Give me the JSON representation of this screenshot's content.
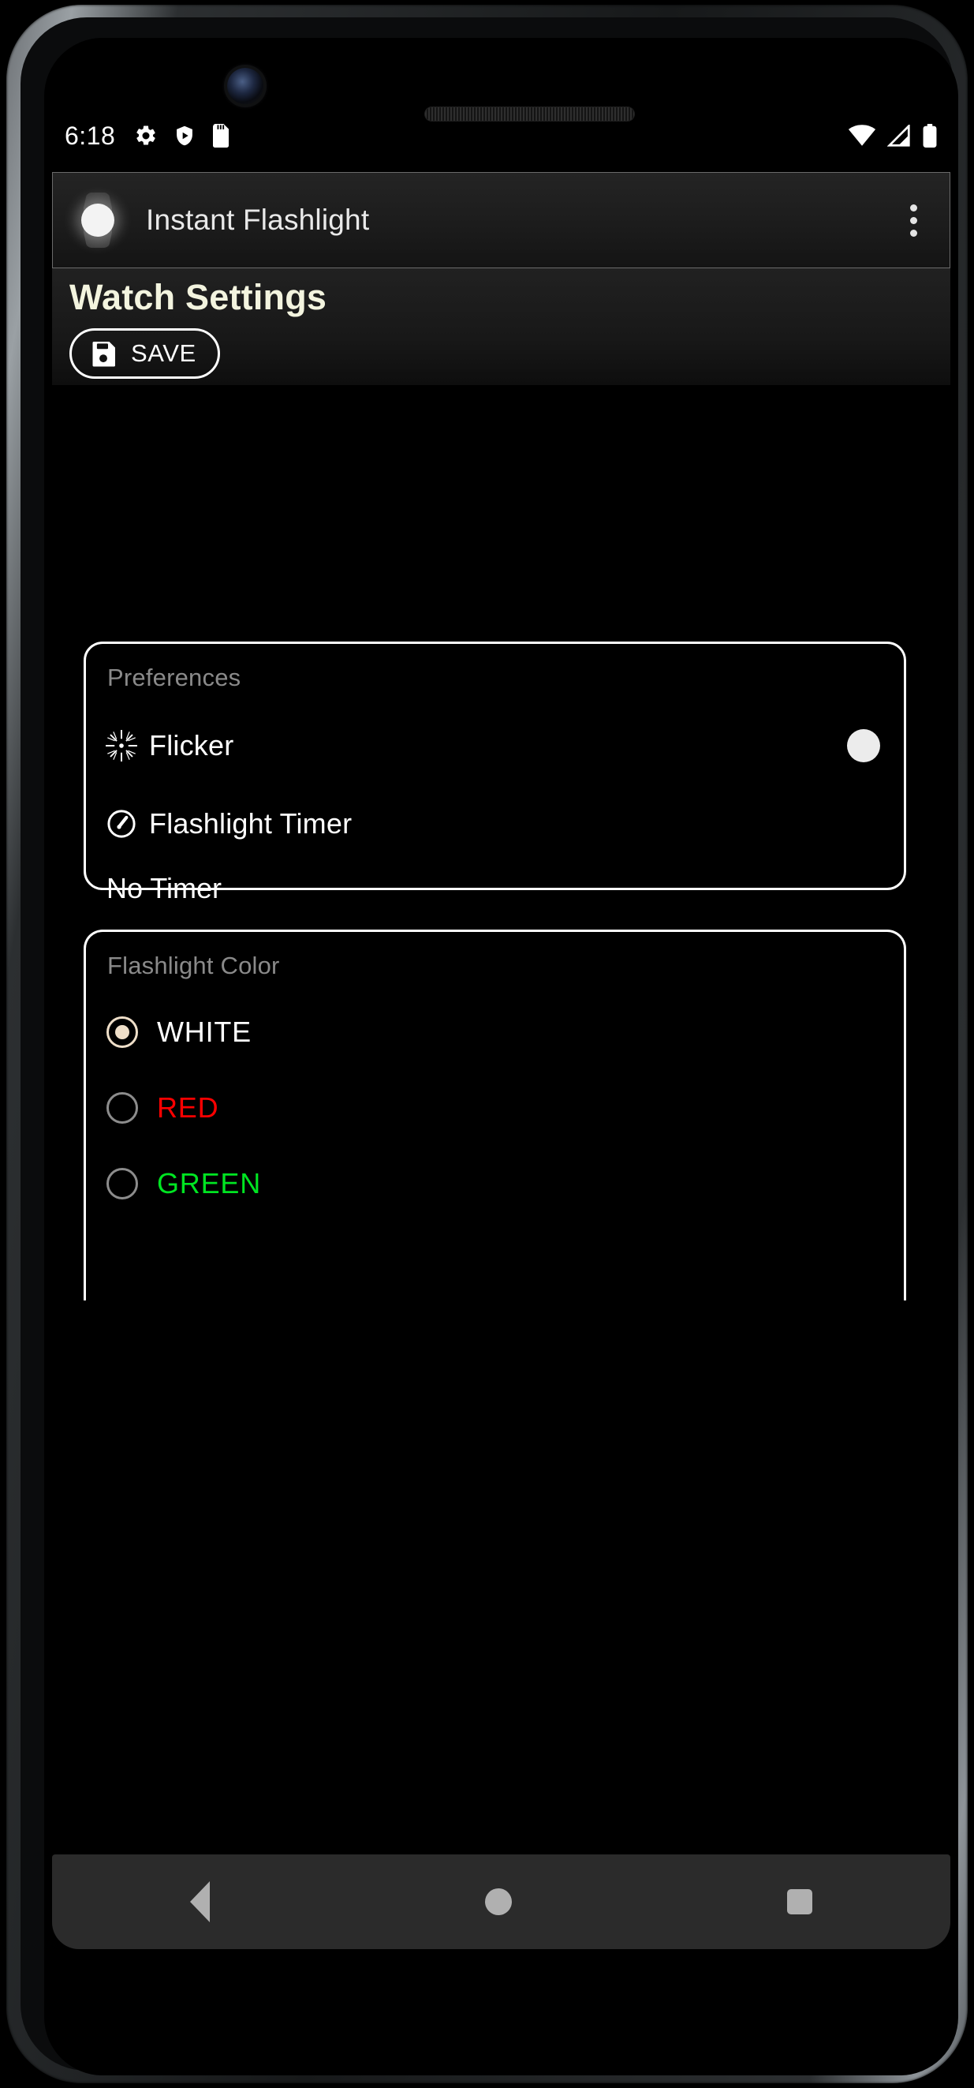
{
  "status_bar": {
    "time": "6:18",
    "left_icons": [
      "gear-icon",
      "play-protect-shield-icon",
      "sd-card-icon"
    ],
    "right_icons": [
      "wifi-icon",
      "cell-signal-icon",
      "battery-icon"
    ]
  },
  "app_bar": {
    "icon": "smartwatch-icon",
    "title": "Instant Flashlight",
    "overflow_icon": "overflow-menu-icon"
  },
  "header": {
    "title": "Watch Settings",
    "save_label": "SAVE",
    "save_icon": "floppy-disk-save-icon",
    "title_color": "#F3F4DF"
  },
  "preferences_card": {
    "heading": "Preferences",
    "rows": [
      {
        "label": "Flicker",
        "icon": "sparkle-flicker-icon",
        "toggle": "on"
      },
      {
        "label": "Flashlight Timer",
        "icon": "timer-gauge-icon",
        "value": "No Timer"
      }
    ]
  },
  "flashlight_color_card": {
    "heading": "Flashlight Color",
    "selected": "WHITE",
    "options": [
      {
        "label": "WHITE",
        "color": "#FFFFFF",
        "selected": true
      },
      {
        "label": "RED",
        "color": "#FF0000",
        "selected": false
      },
      {
        "label": "GREEN",
        "color": "#00E522",
        "selected": false
      }
    ]
  },
  "nav_bar": {
    "back": "back-triangle-icon",
    "home": "home-circle-icon",
    "recents": "recents-square-icon"
  }
}
